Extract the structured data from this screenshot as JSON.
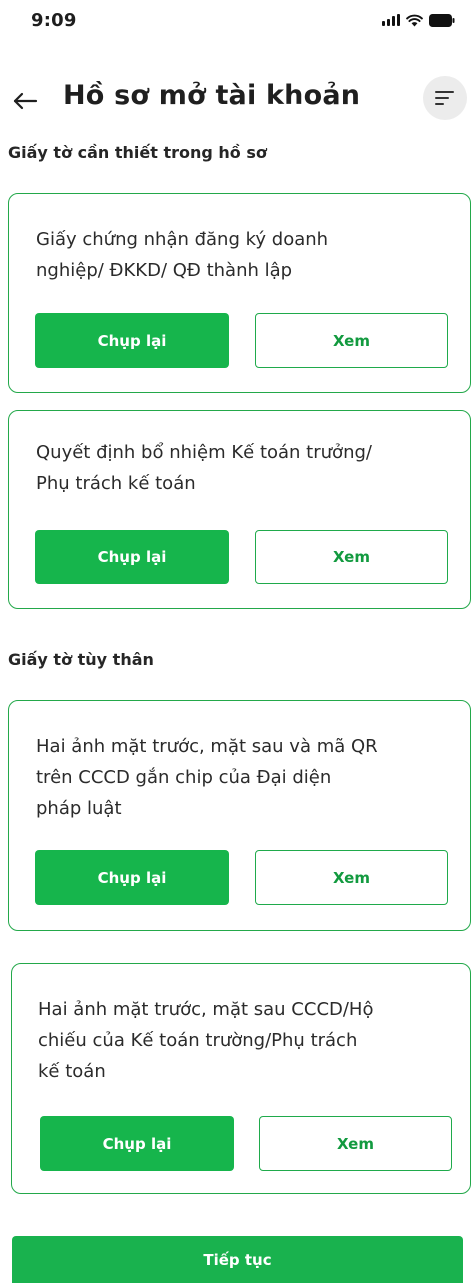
{
  "status_bar": {
    "time": "9:09"
  },
  "header": {
    "title": "Hồ sơ mở tài khoản"
  },
  "sections": [
    {
      "title": "Giấy tờ cần thiết trong hồ sơ"
    },
    {
      "title": "Giấy tờ tùy thân"
    }
  ],
  "documents": [
    {
      "lines": [
        "Giấy chứng nhận đăng ký doanh",
        "nghiệp/ ĐKKD/ QĐ thành lập"
      ],
      "capture_label": "Chụp lại",
      "view_label": "Xem"
    },
    {
      "lines": [
        "Quyết định bổ nhiệm Kế toán trưởng/",
        "Phụ trách kế toán"
      ],
      "capture_label": "Chụp lại",
      "view_label": "Xem"
    },
    {
      "lines": [
        "Hai ảnh mặt trước, mặt sau và mã QR",
        "trên CCCD gắn chip của Đại diện",
        "pháp luật"
      ],
      "capture_label": "Chụp lại",
      "view_label": "Xem"
    },
    {
      "lines": [
        "Hai ảnh mặt trước, mặt sau CCCD/Hộ",
        "chiếu của Kế toán trường/Phụ trách",
        "kế toán"
      ],
      "capture_label": "Chụp lại",
      "view_label": "Xem"
    }
  ],
  "footer": {
    "continue_label": "Tiếp tục"
  },
  "colors": {
    "primary": "#16b54c",
    "card_border": "#23a84a",
    "view_text": "#129a3f"
  },
  "icons": {
    "back": "arrow-left-icon",
    "filter": "filter-lines-icon",
    "signal": "signal-icon",
    "wifi": "wifi-icon",
    "battery": "battery-icon"
  }
}
